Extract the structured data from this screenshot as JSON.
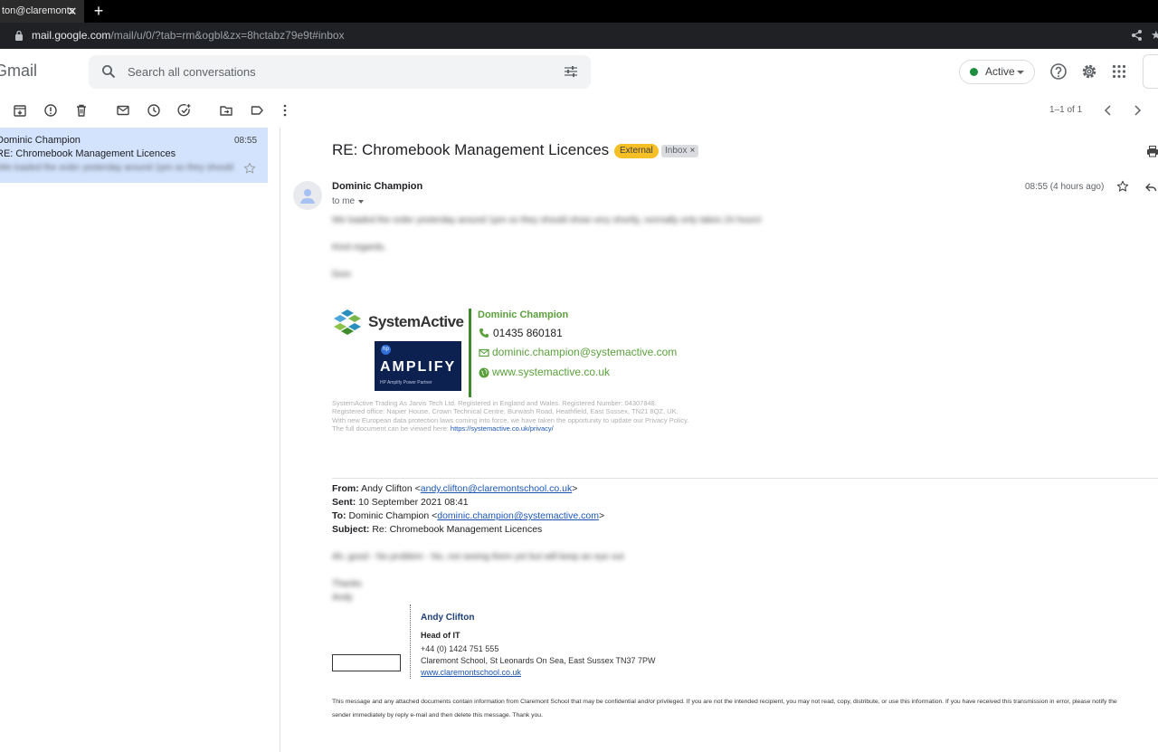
{
  "browser": {
    "tab_title": "ton@claremonts",
    "url_host": "mail.google.com",
    "url_path": "/mail/u/0/?tab=rm&ogbl&zx=8hctabz79e9t#inbox"
  },
  "header": {
    "logo_text": "Gmail",
    "search_placeholder": "Search all conversations",
    "status_label": "Active",
    "status_color": "#1e8e3e"
  },
  "toolbar": {
    "pager": "1–1 of 1"
  },
  "list": {
    "rows": [
      {
        "sender": "Dominic Champion",
        "time": "08:55",
        "subject": "RE: Chromebook Management Licences",
        "snippet": "We loaded the order yesterday around 1pm so they should show very shortly"
      }
    ]
  },
  "message": {
    "subject": "RE: Chromebook Management Licences",
    "labels": {
      "external": "External",
      "inbox": "Inbox"
    },
    "sender": "Dominic Champion",
    "to": "to me",
    "time": "08:55 (4 hours ago)",
    "body": {
      "line1": "We loaded the order yesterday around 1pm so they should show very shortly, normally only takes 24 hours!",
      "line2": "Kind regards,",
      "line3": "Dom"
    },
    "signature": {
      "company": "SystemActive",
      "partner_word": "AMPLIFY",
      "partner_sub": "HP Amplify Power Partner",
      "partner_hp": "hp",
      "name": "Dominic Champion",
      "phone": "01435 860181",
      "email": "dominic.champion@systemactive.com",
      "web": "www.systemactive.co.uk",
      "legal_1": "SystemActive Trading As Jarvis Tech Ltd. Registered in England and Wales. Registered Number: 04307848.",
      "legal_2": "Registered office: Napier House, Crown Technical Centre, Burwash Road, Heathfield, East Sussex, TN21 8QZ, UK.",
      "legal_3": "With new European data protection laws coming into force, we have taken the opportunity to update our Privacy Policy.",
      "legal_4": "The full document can be viewed here:",
      "legal_link": "https://systemactive.co.uk/privacy/"
    },
    "quoted": {
      "from_label": "From:",
      "from_name": "Andy Clifton <",
      "from_email": "andy.clifton@claremontschool.co.uk",
      "close": ">",
      "sent_label": "Sent:",
      "sent_value": "10 September 2021 08:41",
      "to_label": "To:",
      "to_name": "Dominic Champion <",
      "to_email": "dominic.champion@systemactive.com",
      "subject_label": "Subject:",
      "subject_value": "Re: Chromebook Management Licences",
      "body_1": "Ah, good - No problem - No, not seeing them yet but will keep an eye out",
      "body_2": "Thanks",
      "body_3": "Andy"
    },
    "clifton_sig": {
      "name": "Andy Clifton",
      "title": "Head of IT",
      "phone": "+44 (0) 1424 751 555",
      "address": "Claremont School, St Leonards On Sea, East Sussex TN37 7PW",
      "web": "www.claremontschool.co.uk"
    },
    "disclaimer_1": "This message and any attached documents contain information from Claremont School that may be confidential and/or privileged. If you are not the intended recipient, you may not read, copy, distribute, or use this information. If you have received this transmission in error, please notify the",
    "disclaimer_2": "sender immediately by reply e-mail and then delete this message. Thank you."
  }
}
